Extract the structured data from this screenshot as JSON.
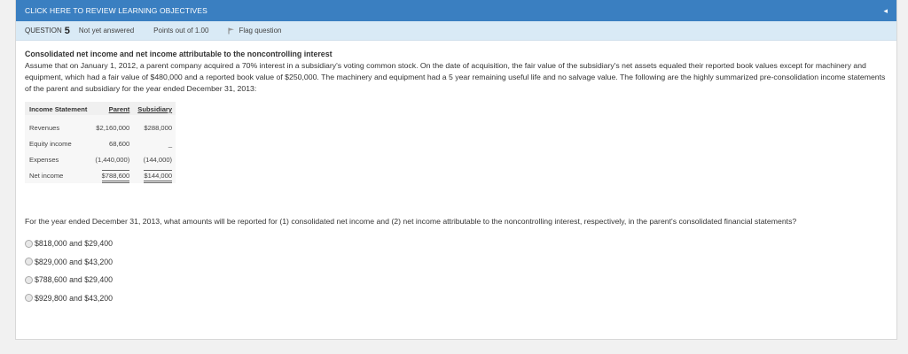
{
  "header": {
    "banner": "CLICK HERE TO REVIEW LEARNING OBJECTIVES",
    "collapse_icon": "triangle-left-icon"
  },
  "status_bar": {
    "question_label": "QUESTION",
    "question_number": "5",
    "answer_status": "Not yet answered",
    "points": "Points out of 1.00",
    "flag_label": "Flag question"
  },
  "question": {
    "title": "Consolidated net income and net income attributable to the noncontrolling interest",
    "body": "Assume that on January 1, 2012, a parent company acquired a 70% interest in a subsidiary's voting common stock. On the date of acquisition, the fair value of the subsidiary's net assets equaled their reported book values except for machinery and equipment, which had a fair value of $480,000 and a reported book value of $250,000. The machinery and equipment had a 5 year remaining useful life and no salvage value. The following are the highly summarized pre-consolidation income statements of the parent and subsidiary for the year ended December 31, 2013:",
    "prompt": "For the year ended December 31, 2013, what amounts will be reported for (1) consolidated net income and (2) net income attributable to the noncontrolling interest, respectively, in the parent's consolidated financial statements?"
  },
  "table": {
    "headers": [
      "Income Statement",
      "Parent",
      "Subsidiary"
    ],
    "rows": [
      {
        "label": "Revenues",
        "parent": "$2,160,000",
        "sub": "$288,000"
      },
      {
        "label": "Equity income",
        "parent": "68,600",
        "sub": "_"
      },
      {
        "label": "Expenses",
        "parent": "(1,440,000)",
        "sub": "(144,000)"
      },
      {
        "label": "Net income",
        "parent": "$788,600",
        "sub": "$144,000"
      }
    ]
  },
  "options": [
    "$818,000 and $29,400",
    "$829,000 and $43,200",
    "$788,600 and $29,400",
    "$929,800 and $43,200"
  ],
  "colors": {
    "header_bg": "#3a7fc1",
    "subbar_bg": "#d9eaf6"
  }
}
